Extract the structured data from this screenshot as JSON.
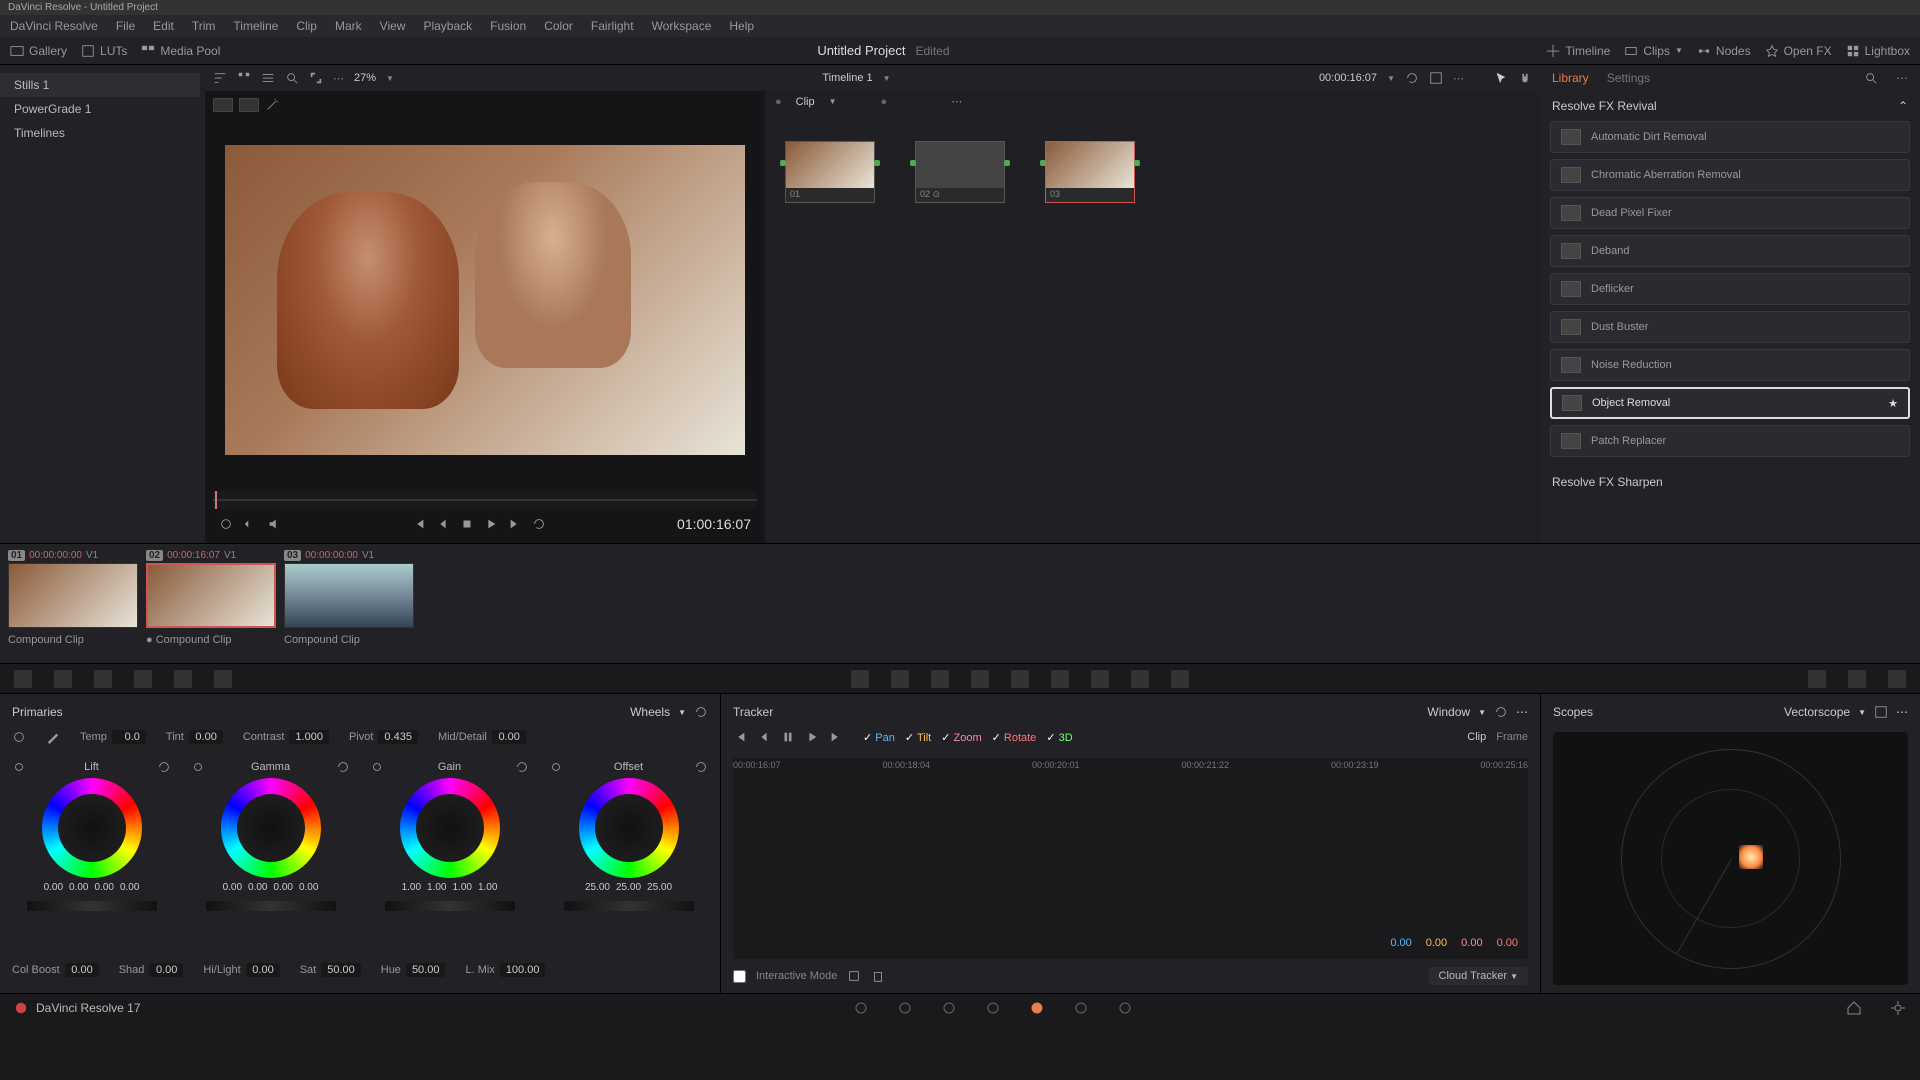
{
  "title": "DaVinci Resolve - Untitled Project",
  "menu": [
    "DaVinci Resolve",
    "File",
    "Edit",
    "Trim",
    "Timeline",
    "Clip",
    "Mark",
    "View",
    "Playback",
    "Fusion",
    "Color",
    "Fairlight",
    "Workspace",
    "Help"
  ],
  "toolbar_left": {
    "gallery": "Gallery",
    "luts": "LUTs",
    "mediapool": "Media Pool"
  },
  "toolbar_right": {
    "timeline": "Timeline",
    "clips": "Clips",
    "nodes": "Nodes",
    "openfx": "Open FX",
    "lightbox": "Lightbox"
  },
  "project": {
    "name": "Untitled Project",
    "status": "Edited"
  },
  "sidebar": {
    "stills": "Stills 1",
    "powergrade": "PowerGrade 1",
    "timelines": "Timelines"
  },
  "viewer": {
    "zoom": "27%",
    "timeline": "Timeline 1",
    "tc": "00:00:16:07",
    "tc_big": "01:00:16:07",
    "clip": "Clip"
  },
  "nodes": [
    {
      "id": "01"
    },
    {
      "id": "02"
    },
    {
      "id": "03"
    }
  ],
  "rp_tabs": {
    "library": "Library",
    "settings": "Settings"
  },
  "fx_section1": "Resolve FX Revival",
  "fx_list": [
    "Automatic Dirt Removal",
    "Chromatic Aberration Removal",
    "Dead Pixel Fixer",
    "Deband",
    "Deflicker",
    "Dust Buster",
    "Noise Reduction",
    "Object Removal",
    "Patch Replacer"
  ],
  "fx_selected": 7,
  "fx_section2": "Resolve FX Sharpen",
  "clips": [
    {
      "num": "01",
      "tc": "00:00:00:00",
      "v": "V1",
      "name": "Compound Clip",
      "sel": false,
      "type": "people"
    },
    {
      "num": "02",
      "tc": "00:00:16:07",
      "v": "V1",
      "name": "Compound Clip",
      "sel": true,
      "type": "people"
    },
    {
      "num": "03",
      "tc": "00:00:00:00",
      "v": "V1",
      "name": "Compound Clip",
      "sel": false,
      "type": "landscape"
    }
  ],
  "primaries": {
    "title": "Primaries",
    "mode": "Wheels",
    "params1": [
      {
        "l": "Temp",
        "v": "0.0"
      },
      {
        "l": "Tint",
        "v": "0.00"
      },
      {
        "l": "Contrast",
        "v": "1.000"
      },
      {
        "l": "Pivot",
        "v": "0.435"
      },
      {
        "l": "Mid/Detail",
        "v": "0.00"
      }
    ],
    "wheels": [
      {
        "name": "Lift",
        "vals": [
          "0.00",
          "0.00",
          "0.00",
          "0.00"
        ]
      },
      {
        "name": "Gamma",
        "vals": [
          "0.00",
          "0.00",
          "0.00",
          "0.00"
        ]
      },
      {
        "name": "Gain",
        "vals": [
          "1.00",
          "1.00",
          "1.00",
          "1.00"
        ]
      },
      {
        "name": "Offset",
        "vals": [
          "25.00",
          "25.00",
          "25.00"
        ]
      }
    ],
    "params2": [
      {
        "l": "Col Boost",
        "v": "0.00"
      },
      {
        "l": "Shad",
        "v": "0.00"
      },
      {
        "l": "Hi/Light",
        "v": "0.00"
      },
      {
        "l": "Sat",
        "v": "50.00"
      },
      {
        "l": "Hue",
        "v": "50.00"
      },
      {
        "l": "L. Mix",
        "v": "100.00"
      }
    ]
  },
  "tracker": {
    "title": "Tracker",
    "mode": "Window",
    "checks": [
      {
        "l": "Pan",
        "c": "pan"
      },
      {
        "l": "Tilt",
        "c": "tilt"
      },
      {
        "l": "Zoom",
        "c": "zoom"
      },
      {
        "l": "Rotate",
        "c": "rot"
      },
      {
        "l": "3D",
        "c": "d3"
      }
    ],
    "clipframe": {
      "clip": "Clip",
      "frame": "Frame"
    },
    "tc_row": [
      "00:00:16:07",
      "00:00:18:04",
      "00:00:20:01",
      "00:00:21:22",
      "00:00:23:19",
      "00:00:25:16"
    ],
    "vals": [
      {
        "v": "0.00",
        "c": "#5bf"
      },
      {
        "v": "0.00",
        "c": "#fb5"
      },
      {
        "v": "0.00",
        "c": "#f8a"
      },
      {
        "v": "0.00",
        "c": "#f77"
      }
    ],
    "interactive": "Interactive Mode",
    "cloud": "Cloud Tracker"
  },
  "scopes": {
    "title": "Scopes",
    "type": "Vectorscope"
  },
  "status": {
    "app": "DaVinci Resolve 17"
  }
}
